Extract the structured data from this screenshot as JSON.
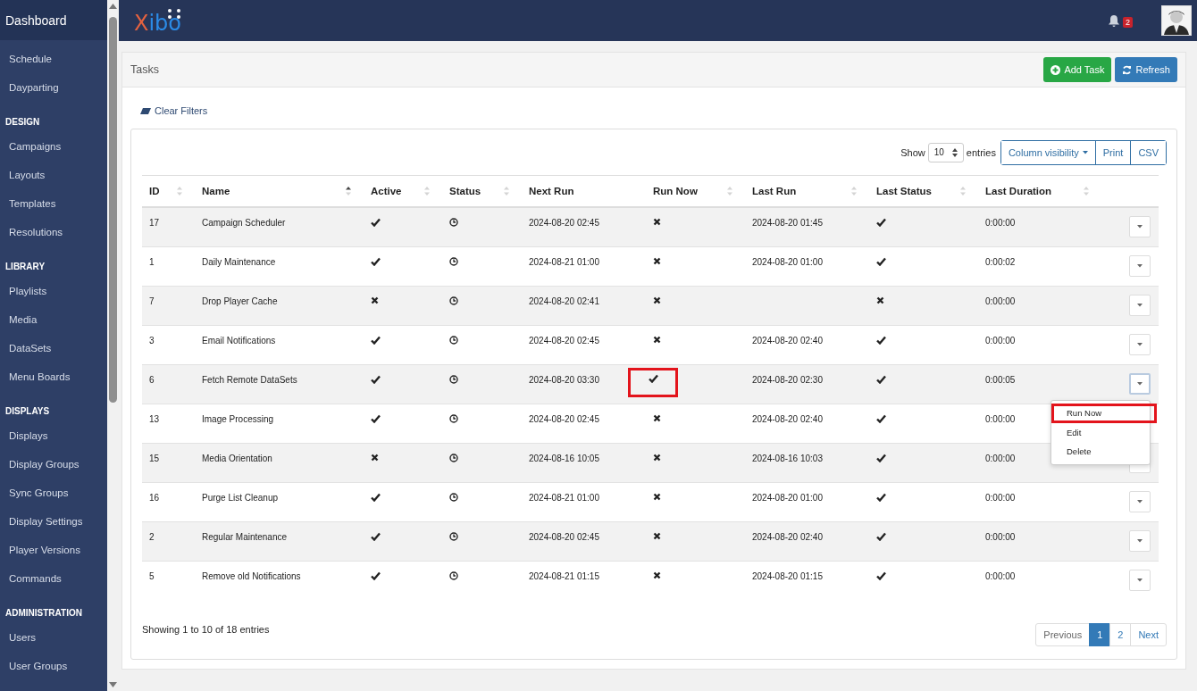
{
  "sidebar": {
    "title": "Dashboard",
    "items": [
      {
        "kind": "link",
        "label": "Schedule"
      },
      {
        "kind": "link",
        "label": "Dayparting"
      },
      {
        "kind": "heading",
        "label": "DESIGN"
      },
      {
        "kind": "link",
        "label": "Campaigns"
      },
      {
        "kind": "link",
        "label": "Layouts"
      },
      {
        "kind": "link",
        "label": "Templates"
      },
      {
        "kind": "link",
        "label": "Resolutions"
      },
      {
        "kind": "heading",
        "label": "LIBRARY"
      },
      {
        "kind": "link",
        "label": "Playlists"
      },
      {
        "kind": "link",
        "label": "Media"
      },
      {
        "kind": "link",
        "label": "DataSets"
      },
      {
        "kind": "link",
        "label": "Menu Boards"
      },
      {
        "kind": "heading",
        "label": "DISPLAYS"
      },
      {
        "kind": "link",
        "label": "Displays"
      },
      {
        "kind": "link",
        "label": "Display Groups"
      },
      {
        "kind": "link",
        "label": "Sync Groups"
      },
      {
        "kind": "link",
        "label": "Display Settings"
      },
      {
        "kind": "link",
        "label": "Player Versions"
      },
      {
        "kind": "link",
        "label": "Commands"
      },
      {
        "kind": "heading",
        "label": "ADMINISTRATION"
      },
      {
        "kind": "link",
        "label": "Users"
      },
      {
        "kind": "link",
        "label": "User Groups"
      }
    ]
  },
  "header": {
    "logo": "Xibo",
    "notifications": "2"
  },
  "page": {
    "title": "Tasks",
    "buttons": [
      {
        "kind": "add",
        "label": "Add Task"
      },
      {
        "kind": "refresh",
        "label": "Refresh"
      }
    ],
    "clear_filters": "Clear Filters"
  },
  "table": {
    "show_label": "Show",
    "page_size": "10",
    "entries_label": "entries",
    "tools": [
      "Column visibility",
      "Print",
      "CSV"
    ],
    "columns": [
      {
        "label": "ID",
        "sortable": true,
        "sorted": false
      },
      {
        "label": "Name",
        "sortable": true,
        "sorted": true
      },
      {
        "label": "Active",
        "sortable": true,
        "sorted": false
      },
      {
        "label": "Status",
        "sortable": true,
        "sorted": false
      },
      {
        "label": "Next Run",
        "sortable": false
      },
      {
        "label": "Run Now",
        "sortable": true,
        "sorted": false
      },
      {
        "label": "Last Run",
        "sortable": true,
        "sorted": false
      },
      {
        "label": "Last Status",
        "sortable": true,
        "sorted": false
      },
      {
        "label": "Last Duration",
        "sortable": true,
        "sorted": false
      }
    ],
    "rows": [
      {
        "id": "17",
        "name": "Campaign Scheduler",
        "active": true,
        "next_run": "2024-08-20 02:45",
        "run_now": false,
        "last_run": "2024-08-20 01:45",
        "last_status": true,
        "last_duration": "0:00:00"
      },
      {
        "id": "1",
        "name": "Daily Maintenance",
        "active": true,
        "next_run": "2024-08-21 01:00",
        "run_now": false,
        "last_run": "2024-08-20 01:00",
        "last_status": true,
        "last_duration": "0:00:02"
      },
      {
        "id": "7",
        "name": "Drop Player Cache",
        "active": false,
        "next_run": "2024-08-20 02:41",
        "run_now": false,
        "last_status": false,
        "last_duration": "0:00:00"
      },
      {
        "id": "3",
        "name": "Email Notifications",
        "active": true,
        "next_run": "2024-08-20 02:45",
        "run_now": false,
        "last_run": "2024-08-20 02:40",
        "last_status": true,
        "last_duration": "0:00:00"
      },
      {
        "id": "6",
        "name": "Fetch Remote DataSets",
        "active": true,
        "next_run": "2024-08-20 03:30",
        "run_now": true,
        "run_now_highlighted": true,
        "last_run": "2024-08-20 02:30",
        "last_status": true,
        "last_duration": "0:00:05",
        "menu": [
          {
            "label": "Run Now",
            "highlighted": true
          },
          {
            "label": "Edit",
            "highlighted": false
          },
          {
            "label": "Delete",
            "highlighted": false
          }
        ]
      },
      {
        "id": "13",
        "name": "Image Processing",
        "active": true,
        "next_run": "2024-08-20 02:45",
        "run_now": false,
        "last_run": "2024-08-20 02:40",
        "last_status": true,
        "last_duration": "0:00:00"
      },
      {
        "id": "15",
        "name": "Media Orientation",
        "active": false,
        "next_run": "2024-08-16 10:05",
        "run_now": false,
        "last_run": "2024-08-16 10:03",
        "last_status": true,
        "last_duration": "0:00:00"
      },
      {
        "id": "16",
        "name": "Purge List Cleanup",
        "active": true,
        "next_run": "2024-08-21 01:00",
        "run_now": false,
        "last_run": "2024-08-20 01:00",
        "last_status": true,
        "last_duration": "0:00:00"
      },
      {
        "id": "2",
        "name": "Regular Maintenance",
        "active": true,
        "next_run": "2024-08-20 02:45",
        "run_now": false,
        "last_run": "2024-08-20 02:40",
        "last_status": true,
        "last_duration": "0:00:00"
      },
      {
        "id": "5",
        "name": "Remove old Notifications",
        "active": true,
        "next_run": "2024-08-21 01:15",
        "run_now": false,
        "last_run": "2024-08-20 01:15",
        "last_status": true,
        "last_duration": "0:00:00"
      }
    ],
    "info": "Showing 1 to 10 of 18 entries",
    "pagination": [
      {
        "label": "Previous",
        "selected": false
      },
      {
        "label": "1",
        "selected": true
      },
      {
        "label": "2",
        "selected": false
      },
      {
        "label": "Next",
        "selected": false
      }
    ]
  }
}
